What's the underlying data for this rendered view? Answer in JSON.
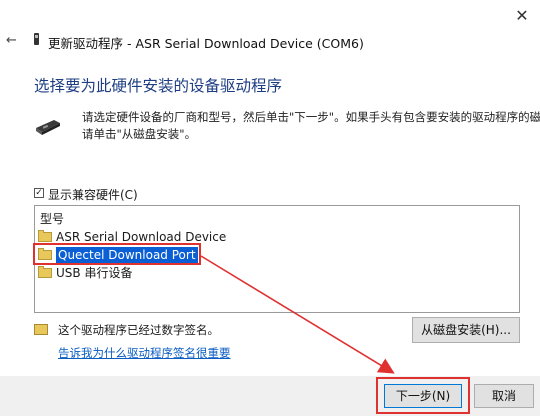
{
  "window": {
    "close_glyph": "✕",
    "back_glyph": "←",
    "title": "更新驱动程序 - ASR Serial Download Device (COM6)"
  },
  "page": {
    "heading": "选择要为此硬件安装的设备驱动程序",
    "instruction_line1": "请选定硬件设备的厂商和型号，然后单击\"下一步\"。如果手头有包含要安装的驱动程序的磁盘，",
    "instruction_line2": "请单击\"从磁盘安装\"。"
  },
  "compat": {
    "check_glyph": "☑",
    "label": "显示兼容硬件(C)"
  },
  "model_list": {
    "header": "型号",
    "items": [
      {
        "label": "ASR Serial Download Device",
        "selected": false
      },
      {
        "label": "Quectel Download Port",
        "selected": true
      },
      {
        "label": "USB 串行设备",
        "selected": false
      }
    ]
  },
  "signature": {
    "status": "这个驱动程序已经过数字签名。",
    "link": "告诉我为什么驱动程序签名很重要"
  },
  "buttons": {
    "have_disk": "从磁盘安装(H)...",
    "next": "下一步(N)",
    "cancel": "取消"
  },
  "colors": {
    "heading": "#1e3d82",
    "selection": "#0b5fd4",
    "annotation_red": "#e03131",
    "link": "#0a5cc2"
  }
}
